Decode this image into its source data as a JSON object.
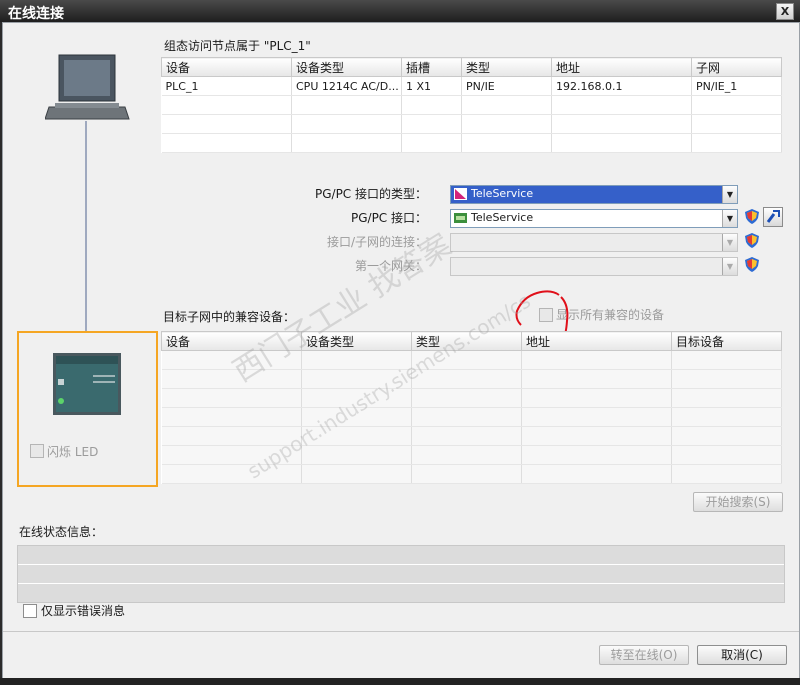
{
  "window": {
    "title": "在线连接",
    "close_label": "X"
  },
  "top_section": {
    "heading": "组态访问节点属于 \"PLC_1\"",
    "columns": [
      "设备",
      "设备类型",
      "插槽",
      "类型",
      "地址",
      "子网"
    ],
    "rows": [
      [
        "PLC_1",
        "CPU 1214C AC/D...",
        "1 X1",
        "PN/IE",
        "192.168.0.1",
        "PN/IE_1"
      ]
    ]
  },
  "interface": {
    "type_label": "PG/PC 接口的类型：",
    "type_value": "TeleService",
    "port_label": "PG/PC 接口：",
    "port_value": "TeleService",
    "subnet_label": "接口/子网的连接：",
    "subnet_value": "",
    "gateway_label": "第一个网关：",
    "gateway_value": ""
  },
  "target_section": {
    "heading": "目标子网中的兼容设备：",
    "show_all_label": "显示所有兼容的设备",
    "columns": [
      "设备",
      "设备类型",
      "类型",
      "地址",
      "目标设备"
    ]
  },
  "flash_led_label": "闪烁 LED",
  "start_search_label": "开始搜索(S)",
  "status": {
    "heading": "在线状态信息："
  },
  "only_errors_label": "仅显示错误消息",
  "buttons": {
    "go_online": "转至在线(O)",
    "cancel": "取消(C)"
  },
  "watermark": {
    "line1": "西门子工业 找答案",
    "line2": "support.industry.siemens.com/cs"
  },
  "colors": {
    "selection_blue": "#3560c9",
    "highlight_orange": "#f5a623",
    "annotation_red": "#e0101a"
  }
}
